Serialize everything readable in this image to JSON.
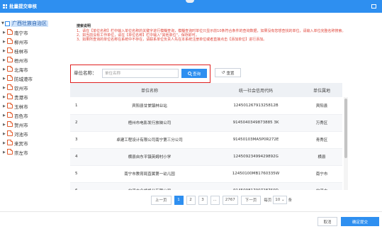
{
  "window": {
    "title": "批量提交审核"
  },
  "tree": {
    "root": "广西壮族自治区",
    "items": [
      "南宁市",
      "柳州市",
      "桂林市",
      "梧州市",
      "北海市",
      "防城港市",
      "钦州市",
      "贵港市",
      "玉林市",
      "百色市",
      "贺州市",
      "河池市",
      "来宾市",
      "崇左市"
    ]
  },
  "instructions": {
    "heading": "搜索说明",
    "lines": [
      "1、请在【单位名称】栏中输入单位名称的关键字进行模糊查询，模糊查询时单位只显示前10条符合条件的查询数据，如果没有您想查找的单位，请输入单位完整名称搜索。",
      "2、如当前没有工作单位，请在【单位名称】栏中输入\"其他单位\"，保存即可。",
      "3、如果所查询的单位名称在系统中不存在，请联系单位负责人先在本系统注册单位或者直接点击【添加单位】进行添加。"
    ]
  },
  "search": {
    "label": "单位名称：",
    "placeholder": "单位名称",
    "button": "查询",
    "reset": "重置"
  },
  "table": {
    "headers": [
      "",
      "单位名称",
      "统一社会信用代码",
      "单位属地"
    ],
    "rows": [
      [
        "1",
        "宾阳县甘棠镇林业站",
        "12450126791325812B",
        "宾阳县"
      ],
      [
        "2",
        "梧州市电影发行放映公司",
        "9145040349873885 3K",
        "万秀区"
      ],
      [
        "3",
        "卓建工程设计有限公司南宁第三分公司",
        "91450103MA5P0R272E",
        "青秀区"
      ],
      [
        "4",
        "横县自东平镇英姆村小学",
        "12450923499429892G",
        "横县"
      ],
      [
        "5",
        "南宁市教育局直属第一幼儿园",
        "12450100MB1760335W",
        "南宁市"
      ],
      [
        "6",
        "北流市全峰蜂业有限公司",
        "914509817007287S0D",
        "北流市"
      ]
    ]
  },
  "pagination": {
    "prev": "上一页",
    "pages": [
      "1",
      "2",
      "3"
    ],
    "ellipsis": "...",
    "last": "2767",
    "next": "下一页",
    "per_page_prefix": "每页",
    "per_page_value": "10",
    "per_page_suffix": "条"
  },
  "footer": {
    "cancel": "取消",
    "confirm": "确定提交"
  },
  "colors": {
    "primary": "#2e8ff0",
    "highlight_border": "#e02020",
    "instruction_text": "#e0453a"
  }
}
